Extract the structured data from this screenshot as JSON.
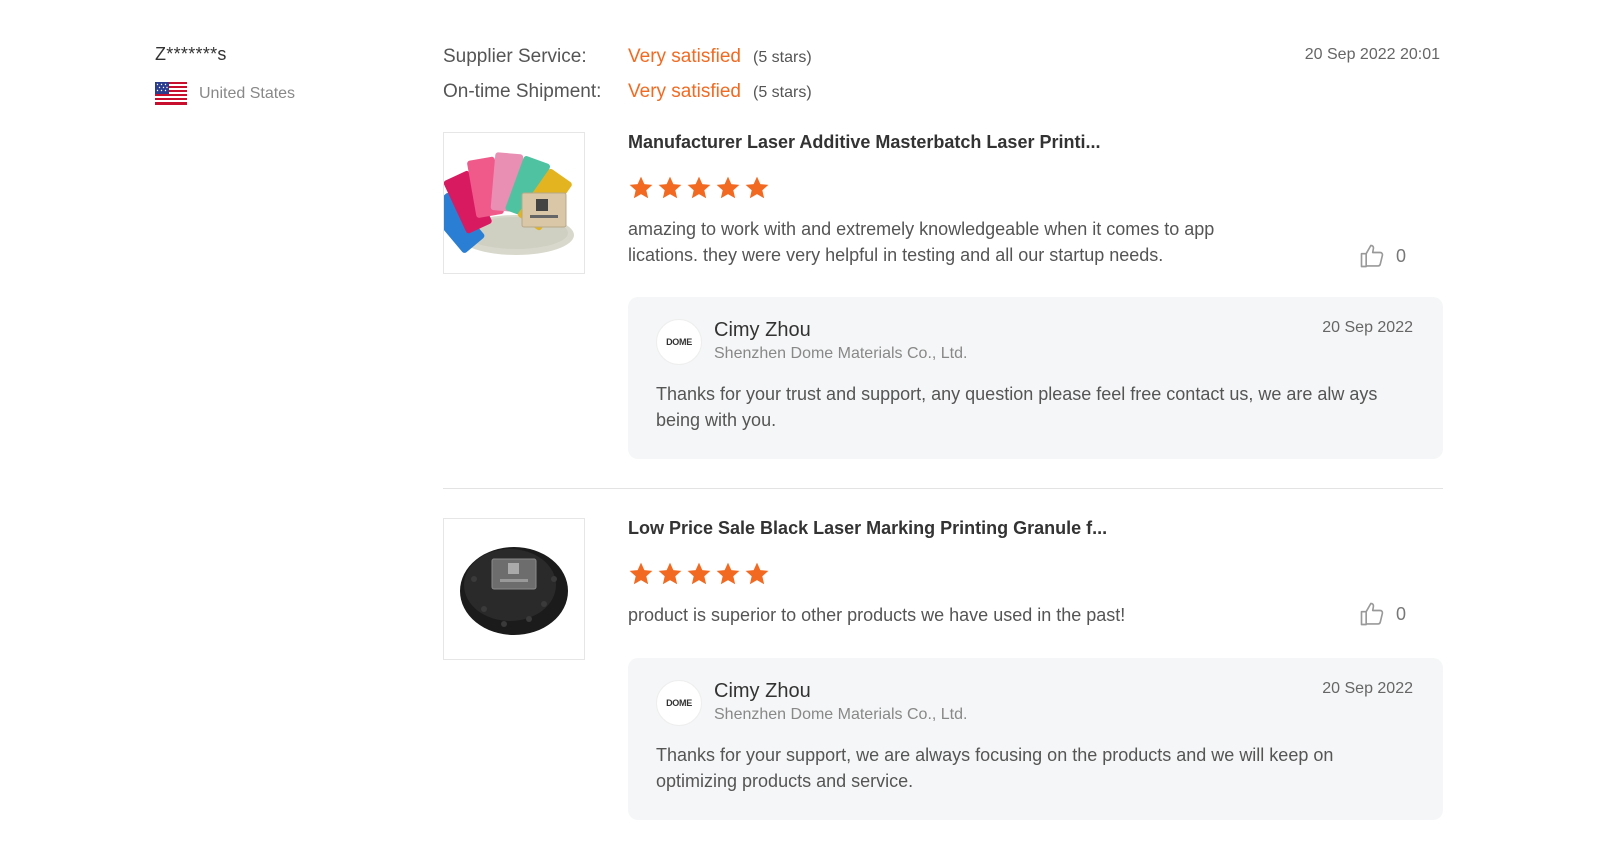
{
  "reviewer": {
    "name": "Z*******s",
    "country": "United States",
    "flag_icon": "us-flag-icon"
  },
  "ratings": [
    {
      "label": "Supplier Service:",
      "value": "Very satisfied",
      "stars": "(5 stars)"
    },
    {
      "label": "On-time Shipment:",
      "value": "Very satisfied",
      "stars": "(5 stars)"
    }
  ],
  "review_date": "20 Sep 2022 20:01",
  "colors": {
    "accent": "#f26a21",
    "reply_bg": "#f5f6f7"
  },
  "products": [
    {
      "title": "Manufacturer Laser Additive Masterbatch Laser Printi...",
      "rating": 5,
      "comment": "amazing to work with and extremely knowledgeable when it comes to app lications. they were very helpful in testing and all our startup needs.",
      "likes": "0",
      "reply": {
        "logo_text": "DOME",
        "name": "Cimy Zhou",
        "company": "Shenzhen Dome Materials Co., Ltd.",
        "date": "20 Sep 2022",
        "text": "Thanks for your trust and support, any question please feel free contact us, we are alw ays being with you."
      }
    },
    {
      "title": "Low Price Sale Black Laser Marking Printing Granule f...",
      "rating": 5,
      "comment": "product is superior to other products we have used in the past!",
      "likes": "0",
      "reply": {
        "logo_text": "DOME",
        "name": "Cimy Zhou",
        "company": "Shenzhen Dome Materials Co., Ltd.",
        "date": "20 Sep 2022",
        "text": "Thanks for your support, we are always focusing on the products and we will keep on optimizing products and service."
      }
    }
  ]
}
